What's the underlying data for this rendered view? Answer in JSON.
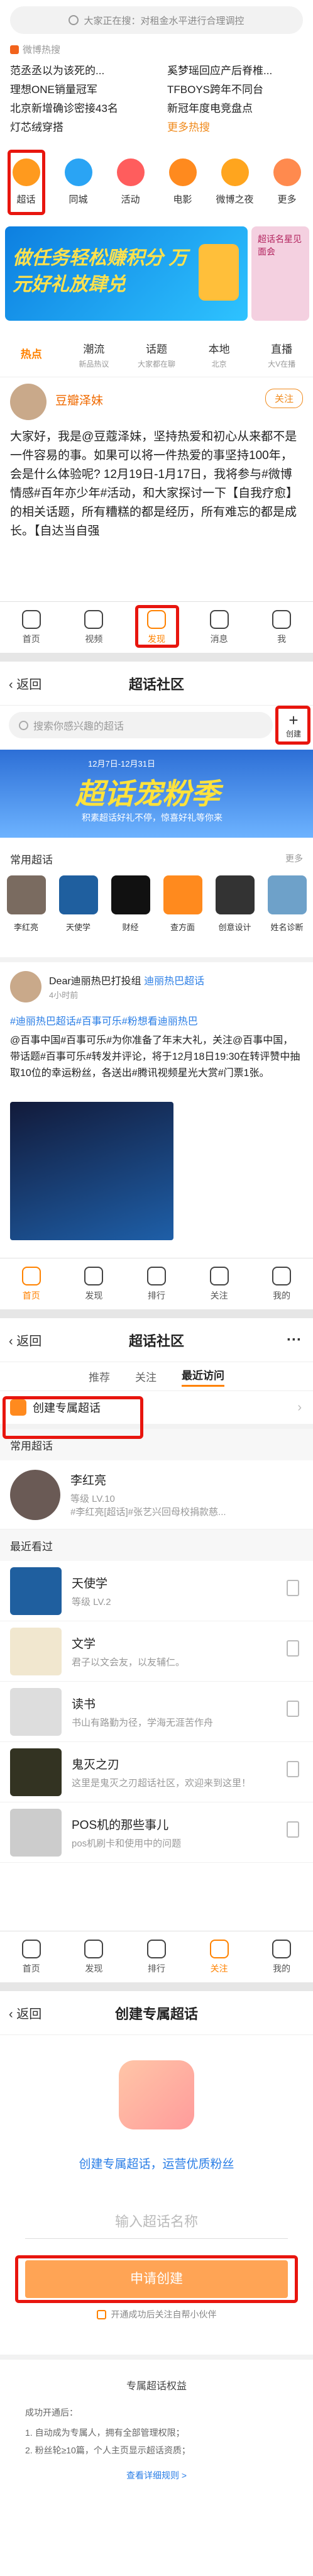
{
  "p1": {
    "search_placeholder": "大家正在搜：对租金水平进行合理调控",
    "hot_title": "微博热搜",
    "hot_left": [
      "范丞丞以为该死的...",
      "理想ONE销量冠军",
      "北京新增确诊密接43名",
      "灯芯绒穿搭"
    ],
    "hot_right": [
      "奚梦瑶回应产后脊椎...",
      "TFBOYS跨年不同台",
      "新冠年度电竞盘点",
      "更多热搜"
    ],
    "menu": [
      "超话",
      "同城",
      "活动",
      "电影",
      "微博之夜",
      "更多"
    ],
    "banner_text": "做任务轻松赚积分 万元好礼放肆兑",
    "banner_side": "超话名星见面会",
    "tabs": [
      "热点",
      "潮流",
      "话题",
      "本地",
      "直播"
    ],
    "tab_subs": [
      "",
      "新品热议",
      "大家都在聊",
      "北京",
      "大V在播"
    ],
    "post_user": "豆瓣泽妹",
    "post_badge": "关注",
    "post_text": "大家好，我是@豆蔻泽妹，坚持热爱和初心从来都不是一件容易的事。如果可以将一件热爱的事坚持100年，会是什么体验呢? 12月19日-1月17日，我将参与#微博情感#百年亦少年#活动，和大家探讨一下【自我疗愈】的相关话题，所有糟糕的都是经历，所有难忘的都是成长。【自达当自强",
    "tabbar": [
      "首页",
      "视频",
      "发现",
      "消息",
      "我"
    ]
  },
  "p2": {
    "back": "返回",
    "title": "超话社区",
    "search_placeholder": "搜索你感兴趣的超话",
    "create_label": "创建",
    "banner_date": "12月7日-12月31日",
    "banner_big": "超话宠粉季",
    "banner_sub": "积素超话好礼不停，惊喜好礼等你来",
    "common_title": "常用超话",
    "common_more": "更多",
    "common": [
      "李红亮",
      "天使学",
      "财经",
      "查方面",
      "创意设计",
      "姓名诊断"
    ],
    "post_user": "Dear迪丽热巴打投组",
    "post_tag": "迪丽热巴超话",
    "post_time": "4小时前",
    "post_line1": "#迪丽热巴超话#百事可乐#粉想看迪丽热巴",
    "post_line2": "@百事中国#百事可乐#为你准备了年末大礼，关注@百事中国，带话题#百事可乐#转发并评论，将于12月18日19:30在转评赞中抽取10位的幸运粉丝，各送出#腾讯视频星光大赏#门票1张。",
    "post_actions": [
      "首页",
      "发现",
      "排行",
      "关注",
      "我的"
    ]
  },
  "p3": {
    "back": "返回",
    "title": "超话社区",
    "tabs": [
      "推荐",
      "关注",
      "最近访问"
    ],
    "create_label": "创建专属超话",
    "common_title": "常用超话",
    "star_name": "李红亮",
    "star_level": "等级 LV.10",
    "star_sub": "#李红亮[超话]#张艺兴回母校捐款慈...",
    "recent_title": "最近看过",
    "recent": [
      {
        "name": "天使学",
        "sub": "等级 LV.2"
      },
      {
        "name": "文学",
        "sub": "君子以文会友，以友辅仁。"
      },
      {
        "name": "读书",
        "sub": "书山有路勤为径，学海无涯苦作舟"
      },
      {
        "name": "鬼灭之刃",
        "sub": "这里是鬼灭之刃超话社区，欢迎来到这里！"
      },
      {
        "name": "POS机的那些事儿",
        "sub": "pos机刷卡和使用中的问题"
      }
    ],
    "tabbar": [
      "首页",
      "发现",
      "排行",
      "关注",
      "我的"
    ]
  },
  "p4": {
    "back": "返回",
    "title": "创建专属超话",
    "slogan": "创建专属超话，运营优质粉丝",
    "input_placeholder": "输入超话名称",
    "submit": "申请创建",
    "agree": "开通成功后关注自帮小伙伴",
    "rights_title": "专属超话权益",
    "rights_intro": "成功开通后：",
    "rights": [
      "1. 自动成为专属人，拥有全部管理权限；",
      "2. 粉丝轮≥10篇，个人主页显示超话资质；"
    ],
    "rights_link": "查看详细规则 >"
  },
  "colors": {
    "accent": "#ff8200",
    "highlight": "#e8150e",
    "link": "#2a7ee6"
  }
}
